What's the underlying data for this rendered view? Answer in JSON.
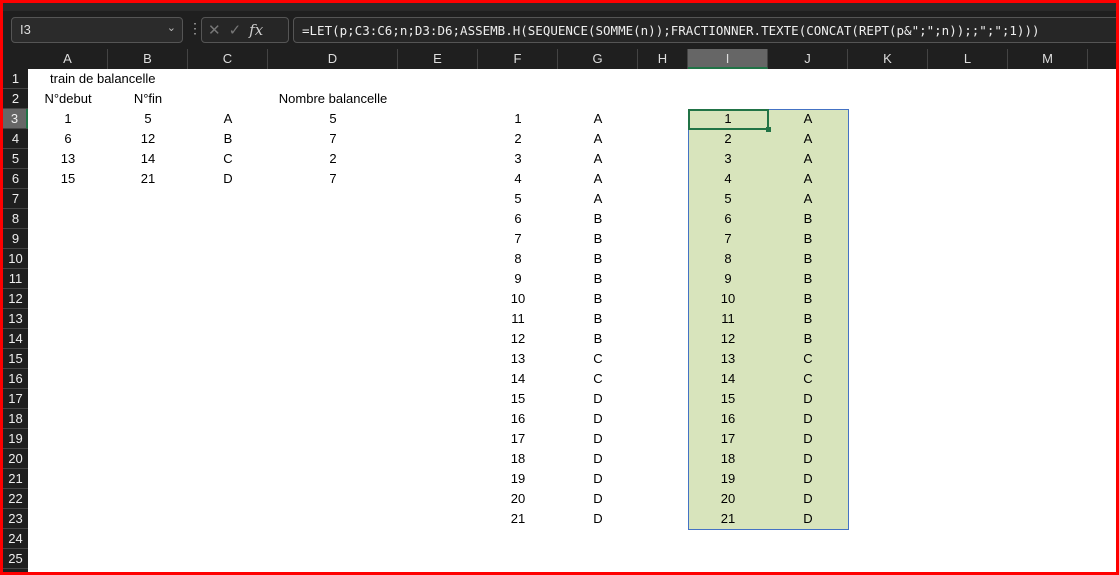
{
  "toolbar": {
    "name_box": "I3",
    "formula": "=LET(p;C3:C6;n;D3:D6;ASSEMB.H(SEQUENCE(SOMME(n));FRACTIONNER.TEXTE(CONCAT(REPT(p&\";\";n));;\";\";1)))"
  },
  "columns": [
    "A",
    "B",
    "C",
    "D",
    "E",
    "F",
    "G",
    "H",
    "I",
    "J",
    "K",
    "L",
    "M"
  ],
  "selected_column": "I",
  "rows": [
    "1",
    "2",
    "3",
    "4",
    "5",
    "6",
    "7",
    "8",
    "9",
    "10",
    "11",
    "12",
    "13",
    "14",
    "15",
    "16",
    "17",
    "18",
    "19",
    "20",
    "21",
    "22",
    "23",
    "24",
    "25"
  ],
  "selected_row": "3",
  "title": "train de balancelle",
  "headers": {
    "a": "N°debut",
    "b": "N°fin",
    "d": "Nombre balancelle"
  },
  "table": [
    {
      "debut": "1",
      "fin": "5",
      "code": "A",
      "nombre": "5"
    },
    {
      "debut": "6",
      "fin": "12",
      "code": "B",
      "nombre": "7"
    },
    {
      "debut": "13",
      "fin": "14",
      "code": "C",
      "nombre": "2"
    },
    {
      "debut": "15",
      "fin": "21",
      "code": "D",
      "nombre": "7"
    }
  ],
  "result_fg": {
    "numbers": [
      "1",
      "2",
      "3",
      "4",
      "5",
      "6",
      "7",
      "8",
      "9",
      "10",
      "11",
      "12",
      "13",
      "14",
      "15",
      "16",
      "17",
      "18",
      "19",
      "20",
      "21"
    ],
    "letters": [
      "A",
      "A",
      "A",
      "A",
      "A",
      "B",
      "B",
      "B",
      "B",
      "B",
      "B",
      "B",
      "C",
      "C",
      "D",
      "D",
      "D",
      "D",
      "D",
      "D",
      "D"
    ]
  },
  "result_ij": {
    "numbers": [
      "1",
      "2",
      "3",
      "4",
      "5",
      "6",
      "7",
      "8",
      "9",
      "10",
      "11",
      "12",
      "13",
      "14",
      "15",
      "16",
      "17",
      "18",
      "19",
      "20",
      "21"
    ],
    "letters": [
      "A",
      "A",
      "A",
      "A",
      "A",
      "B",
      "B",
      "B",
      "B",
      "B",
      "B",
      "B",
      "C",
      "C",
      "D",
      "D",
      "D",
      "D",
      "D",
      "D",
      "D"
    ]
  }
}
